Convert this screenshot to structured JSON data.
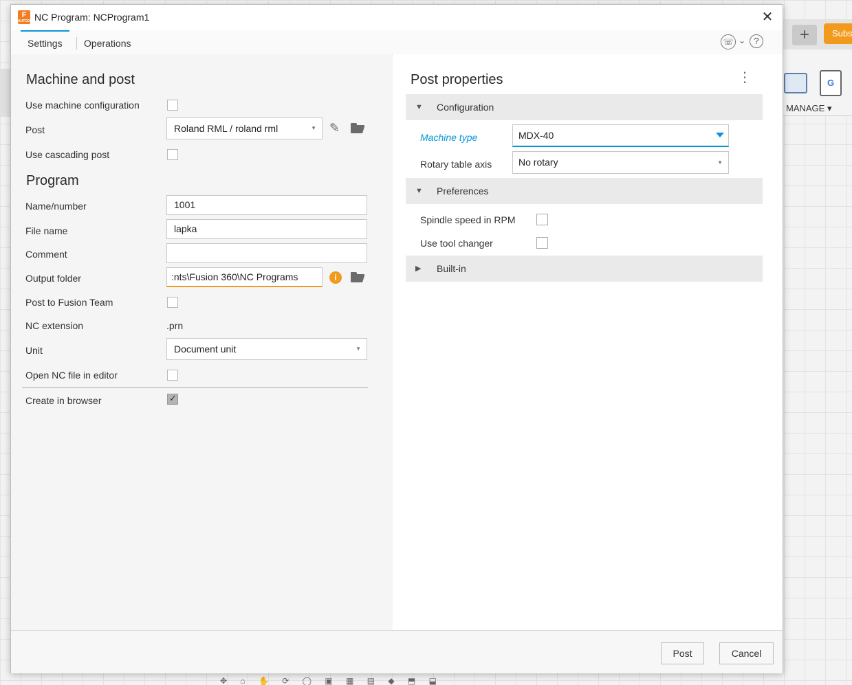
{
  "background": {
    "plus_label": "+",
    "subs_label": "Subs",
    "manage_label": "MANAGE ▾",
    "g_label": "G"
  },
  "dialog": {
    "title": "NC Program: NCProgram1",
    "close_glyph": "✕",
    "tabs": [
      {
        "label": "Settings",
        "active": true
      },
      {
        "label": "Operations",
        "active": false
      }
    ]
  },
  "machine_and_post": {
    "title": "Machine and post",
    "use_machine_configuration": {
      "label": "Use machine configuration",
      "checked": false
    },
    "post": {
      "label": "Post",
      "value": "Roland RML / roland rml"
    },
    "use_cascading_post": {
      "label": "Use cascading post",
      "checked": false
    }
  },
  "program": {
    "title": "Program",
    "name_number": {
      "label": "Name/number",
      "value": "1001"
    },
    "file_name": {
      "label": "File name",
      "value": "lapka"
    },
    "comment": {
      "label": "Comment",
      "value": ""
    },
    "output_folder": {
      "label": "Output folder",
      "value": ":nts\\Fusion 360\\NC Programs"
    },
    "post_to_fusion_team": {
      "label": "Post to Fusion Team",
      "checked": false
    },
    "nc_extension": {
      "label": "NC extension",
      "value": ".prn"
    },
    "unit": {
      "label": "Unit",
      "value": "Document unit"
    },
    "open_nc_file_in_editor": {
      "label": "Open NC file in editor",
      "checked": false
    },
    "create_in_browser": {
      "label": "Create in browser",
      "checked": true
    }
  },
  "post_properties": {
    "title": "Post properties",
    "configuration": {
      "header": "Configuration",
      "machine_type": {
        "label": "Machine type",
        "value": "MDX-40"
      },
      "rotary_table_axis": {
        "label": "Rotary table axis",
        "value": "No rotary"
      }
    },
    "preferences": {
      "header": "Preferences",
      "spindle_speed_in_rpm": {
        "label": "Spindle speed in RPM",
        "checked": false
      },
      "use_tool_changer": {
        "label": "Use tool changer",
        "checked": false
      }
    },
    "built_in": {
      "header": "Built-in"
    }
  },
  "footer": {
    "post_label": "Post",
    "cancel_label": "Cancel"
  },
  "colors": {
    "accent": "#0696d7",
    "warning": "#f29a1c",
    "app_icon": "#f47b20"
  }
}
